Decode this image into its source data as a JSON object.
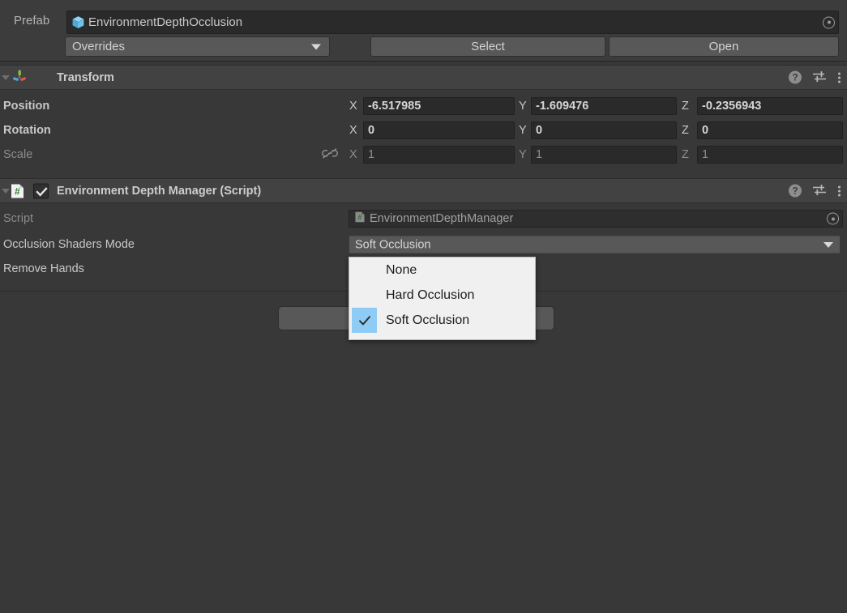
{
  "prefab_bar": {
    "label": "Prefab",
    "field_value": "EnvironmentDepthOcclusion",
    "field_icon": "prefab-cube-icon",
    "picker_icon": "object-picker-icon",
    "overrides_label": "Overrides",
    "select_label": "Select",
    "open_label": "Open"
  },
  "transform": {
    "title": "Transform",
    "icon": "transform-gizmo-icon",
    "help_icon": "help-icon",
    "preset_icon": "preset-settings-icon",
    "menu_icon": "kebab-menu-icon",
    "rows": [
      {
        "label": "Position",
        "x_axis": "X",
        "x_value": "-6.517985",
        "y_axis": "Y",
        "y_value": "-1.609476",
        "z_axis": "Z",
        "z_value": "-0.2356943"
      },
      {
        "label": "Rotation",
        "x_axis": "X",
        "x_value": "0",
        "y_axis": "Y",
        "y_value": "0",
        "z_axis": "Z",
        "z_value": "0"
      },
      {
        "label": "Scale",
        "x_axis": "X",
        "x_value": "1",
        "y_axis": "Y",
        "y_value": "1",
        "z_axis": "Z",
        "z_value": "1",
        "link_icon": "unlinked-scale-icon"
      }
    ]
  },
  "script_component": {
    "title": "Environment Depth Manager (Script)",
    "icon": "csharp-script-icon",
    "enabled": true,
    "help_icon": "help-icon",
    "preset_icon": "preset-settings-icon",
    "menu_icon": "kebab-menu-icon",
    "script_row_label": "Script",
    "script_value": "EnvironmentDepthManager",
    "script_value_icon": "csharp-script-icon",
    "script_picker_icon": "object-picker-icon",
    "occlusion_row_label": "Occlusion Shaders Mode",
    "occlusion_value": "Soft Occlusion",
    "remove_hands_row_label": "Remove Hands"
  },
  "dropdown_menu": {
    "items": [
      {
        "label": "None",
        "selected": false
      },
      {
        "label": "Hard Occlusion",
        "selected": false
      },
      {
        "label": "Soft Occlusion",
        "selected": true
      }
    ],
    "check_icon": "checkmark-icon",
    "highlight_color": "#8ecbf5",
    "background_color": "#f0f0f0"
  },
  "colors": {
    "window_bg": "#383838",
    "header_bg": "#424242",
    "field_bg": "#2a2a2a",
    "button_bg": "#585858",
    "text": "#c8c8c8",
    "text_dim": "#8c8c8c"
  }
}
